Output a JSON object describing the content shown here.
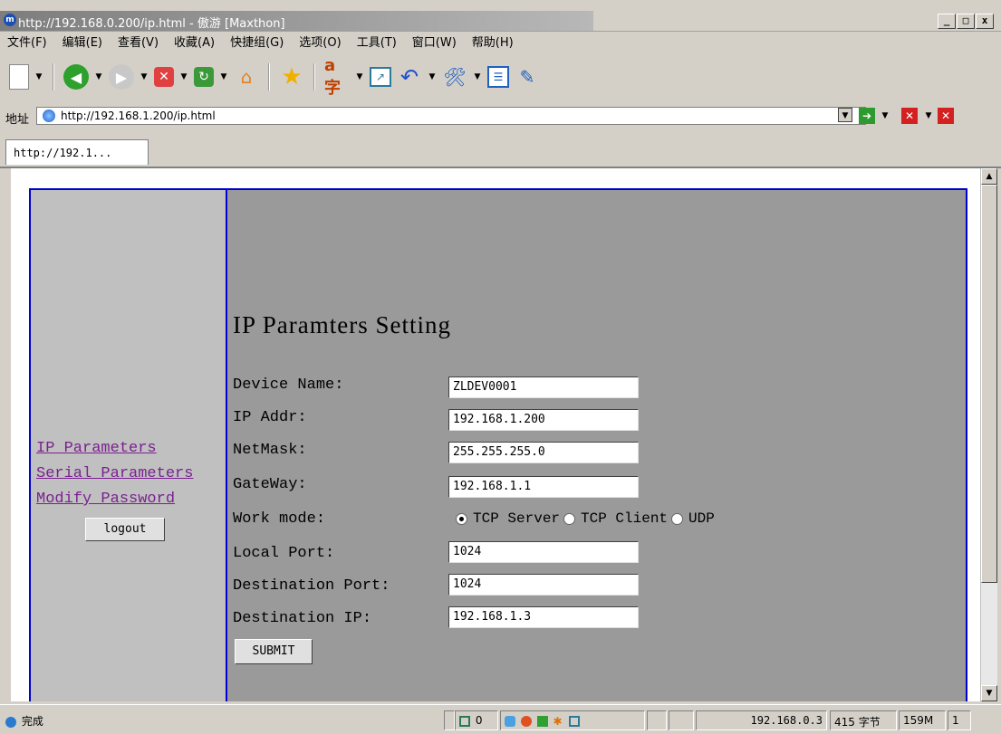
{
  "window": {
    "title": "http://192.168.0.200/ip.html - 傲游 [Maxthon]",
    "controls": [
      "_",
      "□",
      "x"
    ]
  },
  "menu": [
    "文件(F)",
    "编辑(E)",
    "查看(V)",
    "收藏(A)",
    "快捷组(G)",
    "选项(O)",
    "工具(T)",
    "窗口(W)",
    "帮助(H)"
  ],
  "address": {
    "label": "地址",
    "url": "http://192.168.1.200/ip.html"
  },
  "tabs": [
    {
      "label": "http://192.1..."
    }
  ],
  "sidebar": {
    "links": [
      "IP Parameters",
      "Serial Parameters",
      "Modify Password"
    ],
    "logout_label": "logout"
  },
  "form": {
    "title": "IP Paramters Setting",
    "fields": [
      {
        "label": "Device Name:",
        "value": "ZLDEV0001"
      },
      {
        "label": "IP Addr:",
        "value": "192.168.1.200"
      },
      {
        "label": "NetMask:",
        "value": "255.255.255.0"
      },
      {
        "label": "GateWay:",
        "value": "192.168.1.1"
      },
      {
        "label": "Local Port:",
        "value": "1024"
      },
      {
        "label": "Destination Port:",
        "value": "1024"
      },
      {
        "label": "Destination IP:",
        "value": "192.168.1.3"
      }
    ],
    "work_mode": {
      "label": "Work mode:",
      "options": [
        "TCP Server",
        "TCP Client",
        "UDP"
      ],
      "selected": "TCP Server"
    },
    "submit_label": "SUBMIT"
  },
  "status": {
    "text": "完成",
    "count": "0",
    "ip": "192.168.0.3",
    "bytes": "415 字节",
    "memory": "159M",
    "num": "1"
  },
  "colors": {
    "frame_border": "#0000d0",
    "link": "#7a2090",
    "right_pane_bg": "#9a9a9a",
    "left_pane_bg": "#c0c0c0"
  }
}
